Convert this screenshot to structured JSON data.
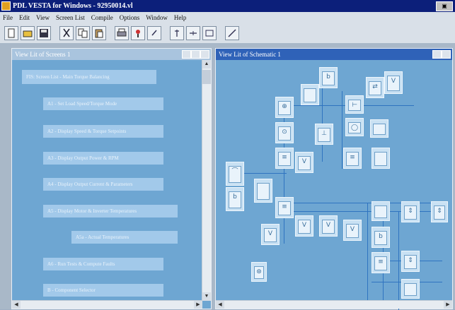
{
  "window": {
    "title": "PDL VESTA for Windows - 92950014.vl"
  },
  "menu": [
    "File",
    "Edit",
    "View",
    "Screen List",
    "Compile",
    "Options",
    "Window",
    "Help"
  ],
  "toolbar": {
    "icons": [
      "new-file-icon",
      "open-file-icon",
      "save-icon",
      "cut-icon",
      "copy-icon",
      "paste-icon",
      "print-icon",
      "properties-icon",
      "help-icon",
      "component-icon",
      "wire-icon",
      "block-icon",
      "tool-icon"
    ]
  },
  "left_window": {
    "title": "View Lit of Screens 1",
    "items": [
      "FIS: Screen List - Main Torque Balancing",
      "A1 - Set Load Speed/Torque Mode",
      "A2 - Display Speed & Torque Setpoints",
      "A3 - Display Output Power & RPM",
      "A4 - Display Output Current & Parameters",
      "A5 - Display Motor & Inverter Temperatures",
      "A5a - Actual Temperatures",
      "A6 - Run Tests & Compute Faults",
      "B - Component Selector"
    ]
  },
  "right_window": {
    "title": "View Lit of Schematic 1"
  },
  "colors": {
    "title_bar": "#0c1f7a",
    "window_bg": "#6ea6d2",
    "block": "#c9e1f3",
    "wire": "#2f74c0"
  }
}
